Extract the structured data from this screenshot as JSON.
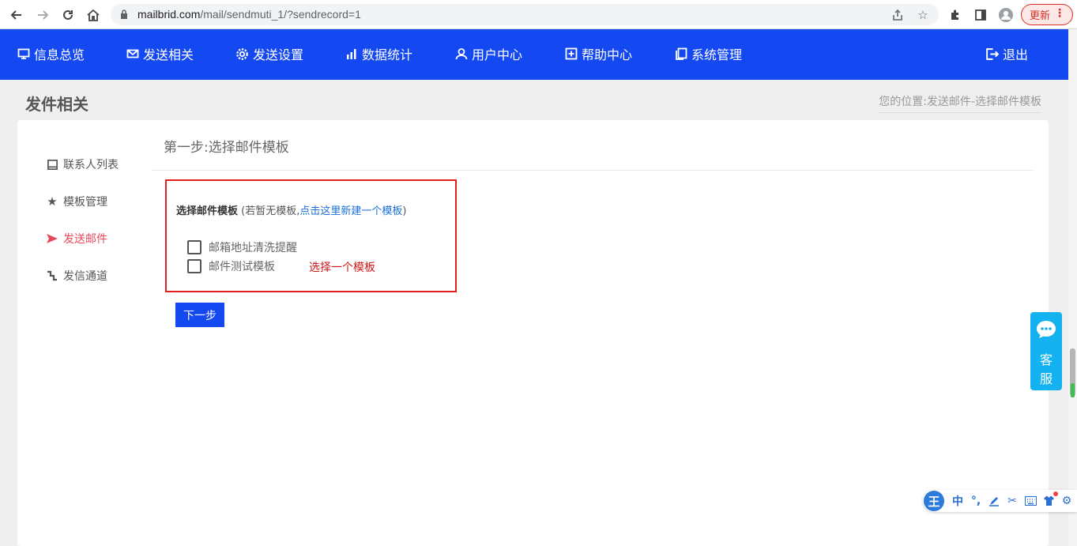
{
  "browser": {
    "url_host": "mailbrid.com",
    "url_path": "/mail/sendmuti_1/?sendrecord=1",
    "update_label": "更新"
  },
  "topnav": {
    "items": [
      {
        "label": "信息总览",
        "icon": "monitor-icon"
      },
      {
        "label": "发送相关",
        "icon": "mail-icon"
      },
      {
        "label": "发送设置",
        "icon": "gear-icon"
      },
      {
        "label": "数据统计",
        "icon": "bar-chart-icon"
      },
      {
        "label": "用户中心",
        "icon": "user-icon"
      },
      {
        "label": "帮助中心",
        "icon": "help-icon"
      },
      {
        "label": "系统管理",
        "icon": "copy-icon"
      }
    ],
    "logout": "退出"
  },
  "page": {
    "title": "发件相关",
    "breadcrumb": "您的位置:发送邮件-选择邮件模板"
  },
  "sidebar": {
    "items": [
      {
        "label": "联系人列表",
        "icon": "contacts-icon",
        "active": false
      },
      {
        "label": "模板管理",
        "icon": "star-icon",
        "active": false
      },
      {
        "label": "发送邮件",
        "icon": "send-icon",
        "active": true
      },
      {
        "label": "发信通道",
        "icon": "channel-icon",
        "active": false
      }
    ]
  },
  "main": {
    "step_title": "第一步:选择邮件模板",
    "select_label": "选择邮件模板",
    "note_prefix": " (若暂无模板,",
    "note_link": "点击这里新建一个模板",
    "note_suffix": ")",
    "templates": [
      {
        "label": "邮箱地址清洗提醒",
        "checked": false
      },
      {
        "label": "邮件测试模板",
        "checked": false
      }
    ],
    "hint": "选择一个模板",
    "next_button": "下一步"
  },
  "cs_widget": {
    "line1": "客",
    "line2": "服"
  },
  "ime": {
    "logo": "王",
    "lang": "中"
  },
  "colors": {
    "nav_bg": "#1448f0",
    "active_side": "#e8485a",
    "highlight_border": "#e02020",
    "cs_widget": "#14b2f0"
  }
}
